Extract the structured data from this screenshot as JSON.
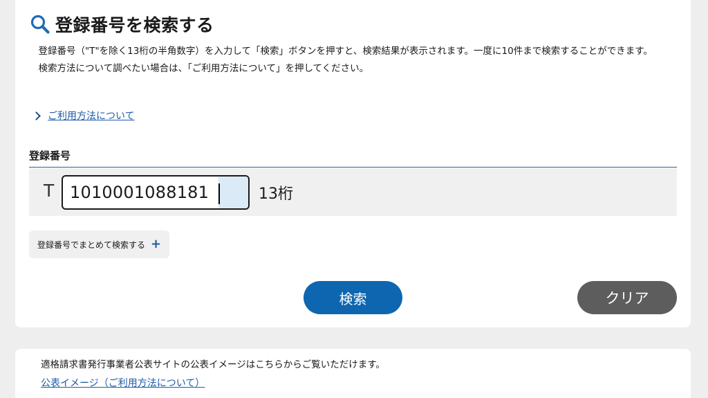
{
  "search_panel": {
    "title": "登録番号を検索する",
    "title_icon": "search-icon",
    "description_1": "登録番号（\"T\"を除く13桁の半角数字）を入力して「検索」ボタンを押すと、検索結果が表示されます。一度に10件まで検索することができます。",
    "description_2": "検索方法について調べたい場合は、「ご利用方法について」を押してください。",
    "usage_link": "ご利用方法について",
    "field_label": "登録番号",
    "prefix": "T",
    "input_value": "1010001088181",
    "digits_label": "13桁",
    "bulk_search_label": "登録番号でまとめて検索する",
    "bulk_search_icon": "plus-icon",
    "search_button": "検索",
    "clear_button": "クリア"
  },
  "info_panel": {
    "text": "適格請求書発行事業者公表サイトの公表イメージはこちらからご覧いただけます。",
    "link": "公表イメージ（ご利用方法について）"
  },
  "colors": {
    "accent": "#0e66b0",
    "link": "#1d5aa8",
    "clear_button": "#5d5d5d",
    "background": "#eeeeee"
  }
}
